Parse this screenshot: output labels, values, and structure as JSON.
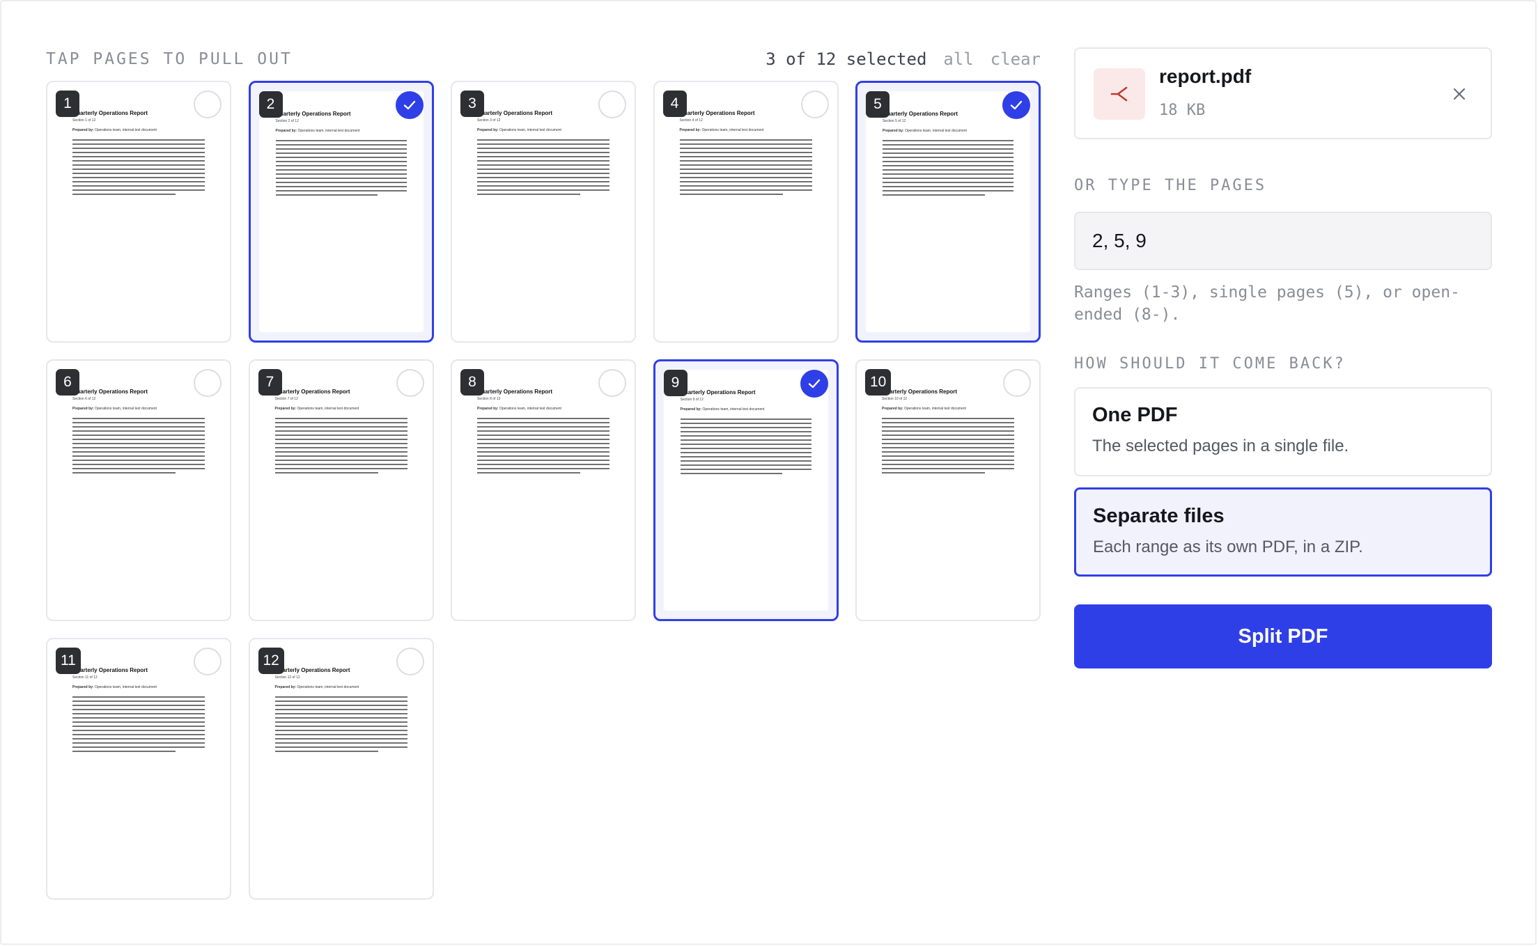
{
  "grid": {
    "title": "TAP PAGES TO PULL OUT",
    "selected_summary": "3 of 12 selected",
    "all_label": "all",
    "clear_label": "clear"
  },
  "document": {
    "title": "Quarterly Operations Report",
    "prepared_label": "Prepared by:",
    "prepared_value": "Operations team, internal test document",
    "body_line_count": 14
  },
  "pages": [
    {
      "number": "1",
      "section": "Section 1 of 12",
      "selected": false
    },
    {
      "number": "2",
      "section": "Section 2 of 12",
      "selected": true
    },
    {
      "number": "3",
      "section": "Section 3 of 12",
      "selected": false
    },
    {
      "number": "4",
      "section": "Section 4 of 12",
      "selected": false
    },
    {
      "number": "5",
      "section": "Section 5 of 12",
      "selected": true
    },
    {
      "number": "6",
      "section": "Section 6 of 12",
      "selected": false
    },
    {
      "number": "7",
      "section": "Section 7 of 12",
      "selected": false
    },
    {
      "number": "8",
      "section": "Section 8 of 12",
      "selected": false
    },
    {
      "number": "9",
      "section": "Section 9 of 12",
      "selected": true
    },
    {
      "number": "10",
      "section": "Section 10 of 12",
      "selected": false
    },
    {
      "number": "11",
      "section": "Section 11 of 12",
      "selected": false
    },
    {
      "number": "12",
      "section": "Section 12 of 12",
      "selected": false
    }
  ],
  "file": {
    "name": "report.pdf",
    "size": "18 KB",
    "icon": "split-icon",
    "close_icon": "close-icon"
  },
  "pages_input": {
    "label": "OR TYPE THE PAGES",
    "value": "2, 5, 9",
    "hint": "Ranges (1-3), single pages (5), or open-ended (8-)."
  },
  "output": {
    "label": "HOW SHOULD IT COME BACK?",
    "options": [
      {
        "title": "One PDF",
        "description": "The selected pages in a single file.",
        "active": false
      },
      {
        "title": "Separate files",
        "description": "Each range as its own PDF, in a ZIP.",
        "active": true
      }
    ]
  },
  "action": {
    "label": "Split PDF"
  },
  "colors": {
    "accent": "#2f3fe8",
    "selected_bg": "#f2f2fd",
    "badge_bg": "#2e2f33",
    "file_icon_bg": "#fbe9e9",
    "file_icon_fg": "#c0392b"
  }
}
